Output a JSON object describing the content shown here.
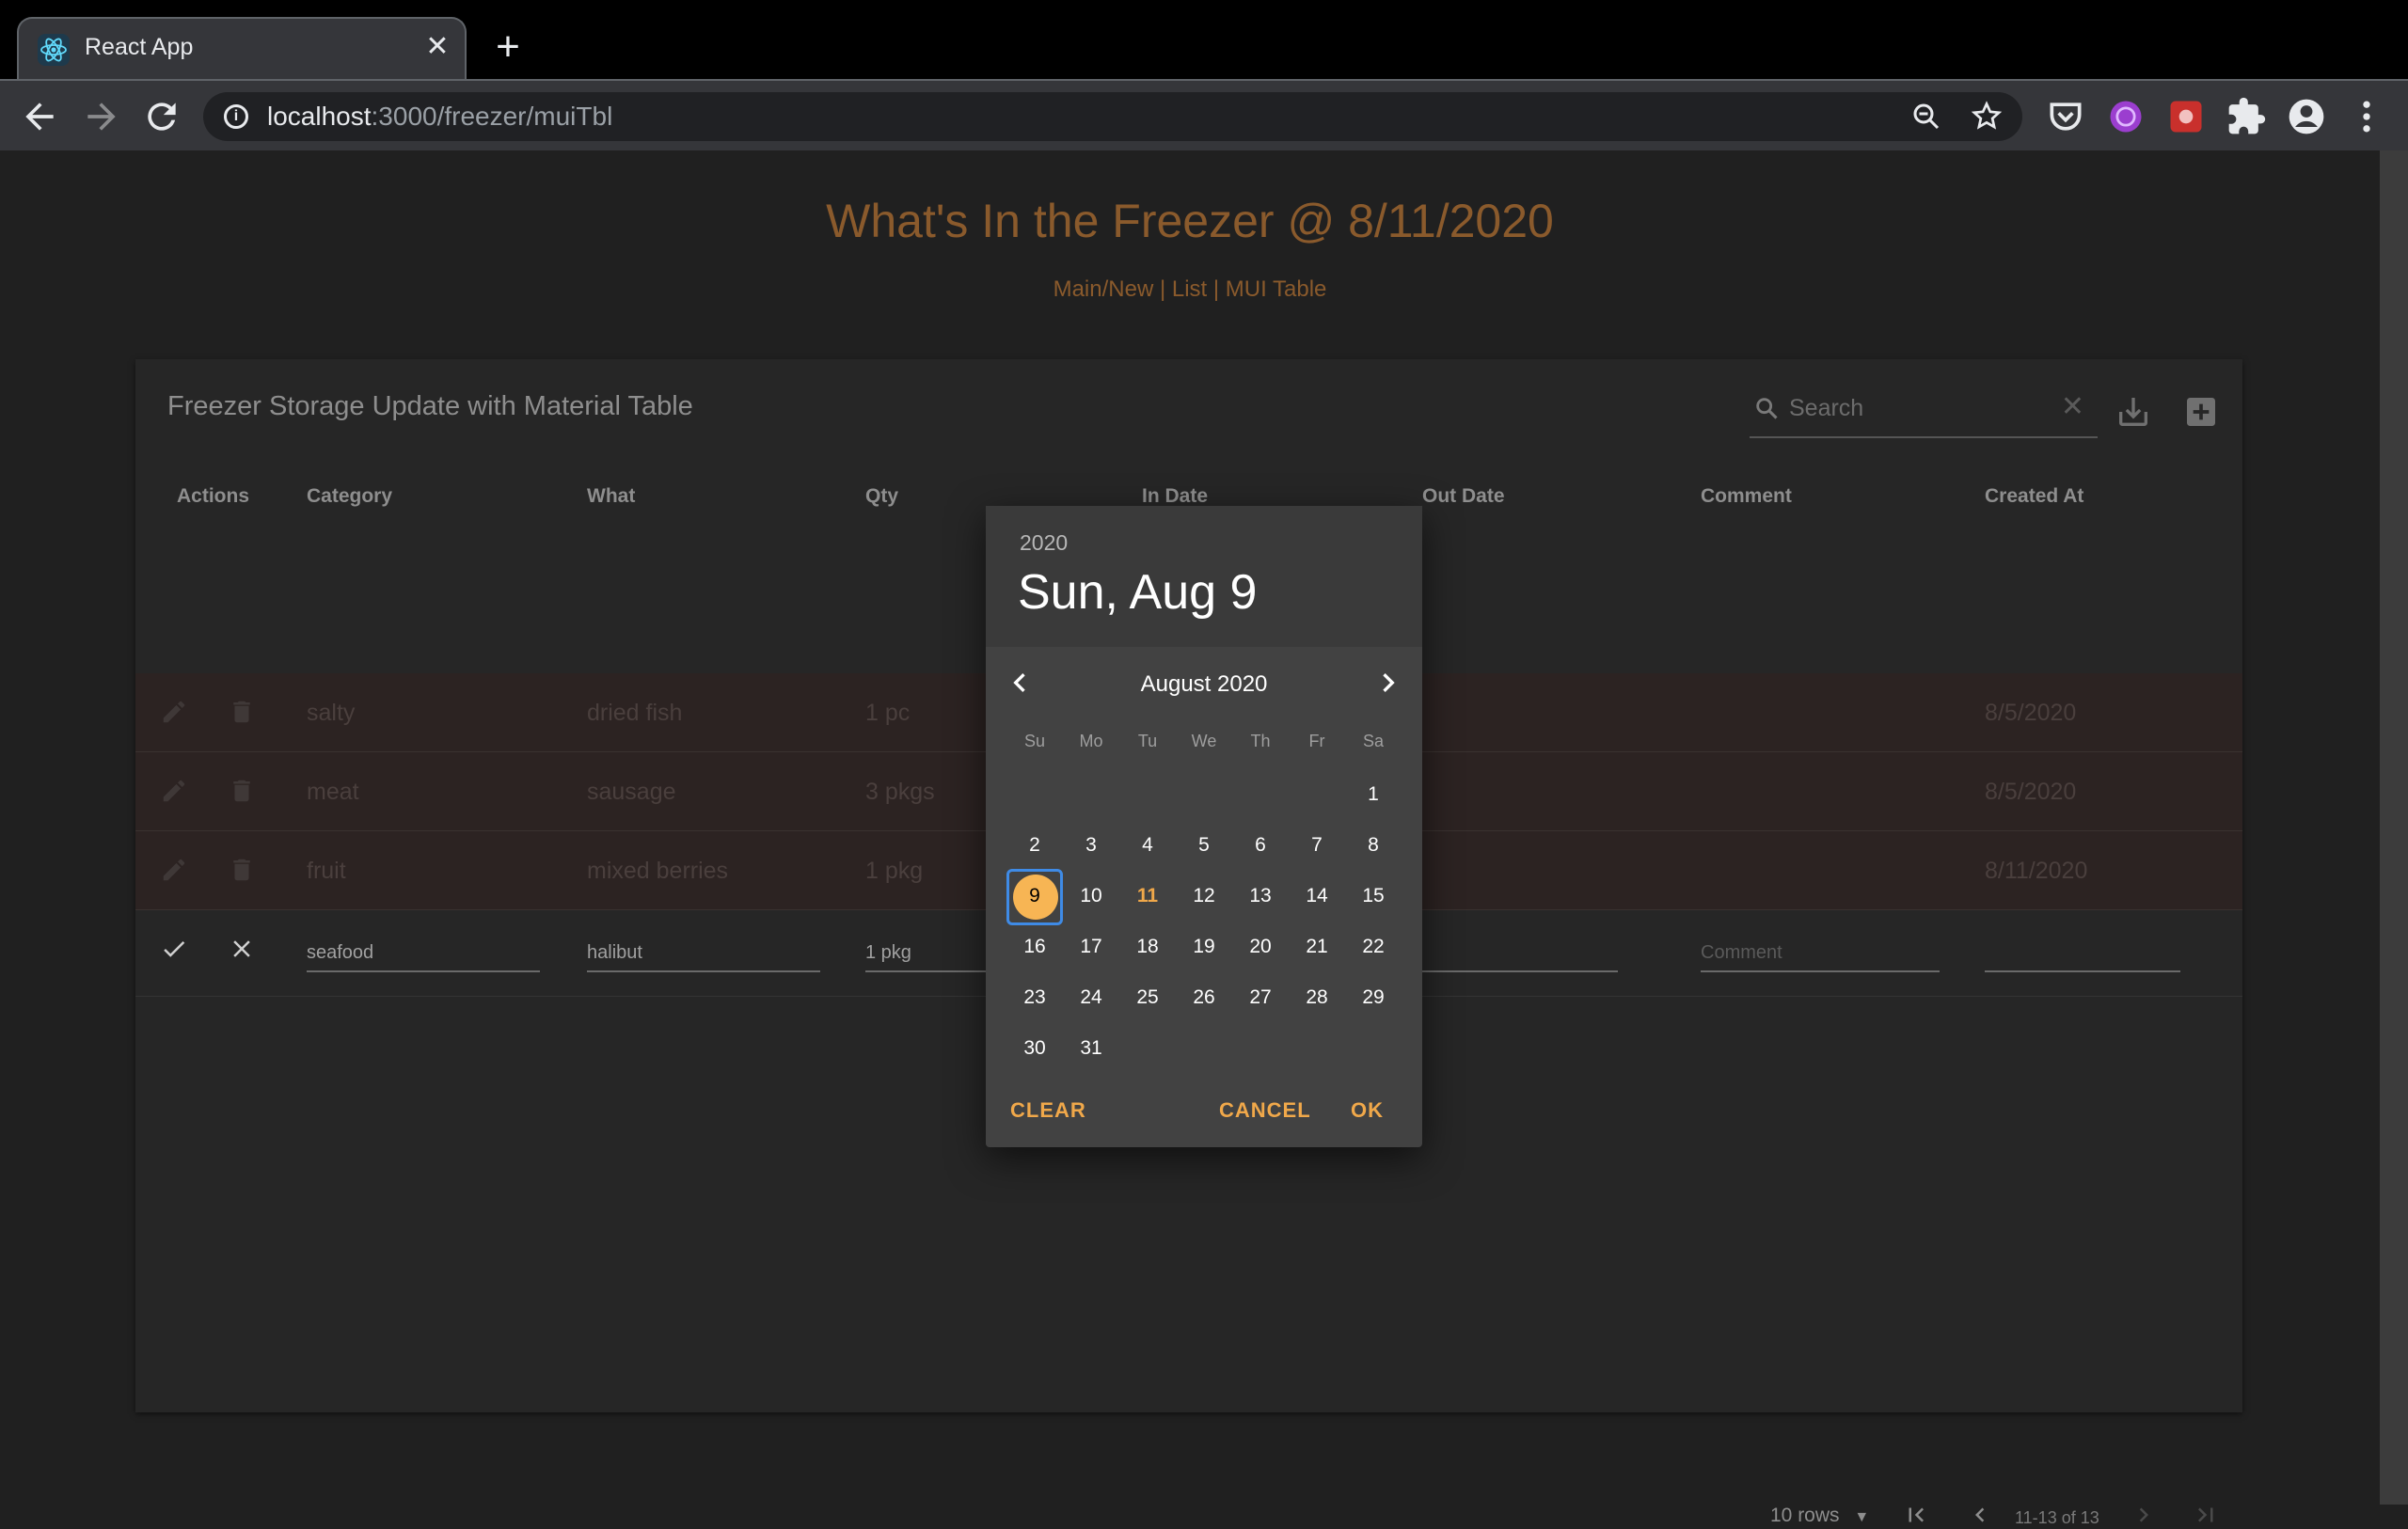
{
  "browser": {
    "tab_title": "React App",
    "url_host": "localhost",
    "url_path": ":3000/freezer/muiTbl"
  },
  "page": {
    "title": "What's In the Freezer @ 8/11/2020",
    "links": "Main/New | List | MUI Table"
  },
  "table": {
    "title": "Freezer Storage Update with Material Table",
    "search_placeholder": "Search",
    "columns": [
      "Actions",
      "Category",
      "What",
      "Qty",
      "In Date",
      "Out Date",
      "Comment",
      "Created At"
    ],
    "rows": [
      {
        "category": "salty",
        "what": "dried fish",
        "qty": "1 pc",
        "created": "8/5/2020"
      },
      {
        "category": "meat",
        "what": "sausage",
        "qty": "3 pkgs",
        "created": "8/5/2020"
      },
      {
        "category": "fruit",
        "what": "mixed berries",
        "qty": "1 pkg",
        "created": "8/11/2020"
      }
    ],
    "edit_row": {
      "category": "seafood",
      "what": "halibut",
      "qty": "1 pkg",
      "comment_placeholder": "Comment"
    },
    "pager": {
      "rows_label": "10 rows",
      "range": "11-13 of 13"
    }
  },
  "date_picker": {
    "year": "2020",
    "selected_label": "Sun, Aug 9",
    "month_label": "August 2020",
    "weekdays": [
      "Su",
      "Mo",
      "Tu",
      "We",
      "Th",
      "Fr",
      "Sa"
    ],
    "days": [
      "1",
      "2",
      "3",
      "4",
      "5",
      "6",
      "7",
      "8",
      "9",
      "10",
      "11",
      "12",
      "13",
      "14",
      "15",
      "16",
      "17",
      "18",
      "19",
      "20",
      "21",
      "22",
      "23",
      "24",
      "25",
      "26",
      "27",
      "28",
      "29",
      "30",
      "31"
    ],
    "selected_day": "9",
    "today_day": "11",
    "clear_label": "CLEAR",
    "cancel_label": "CANCEL",
    "ok_label": "OK",
    "accent_color": "#f0a84a"
  }
}
